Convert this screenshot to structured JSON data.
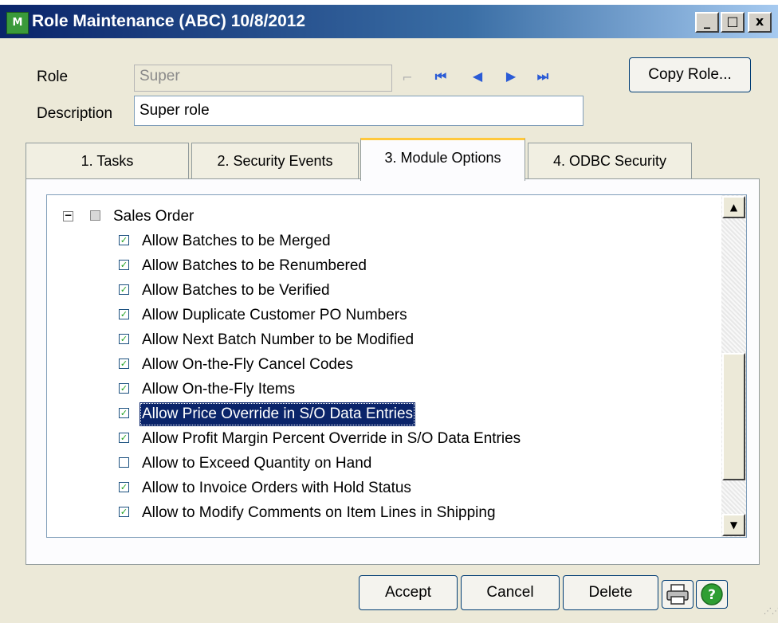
{
  "window": {
    "title": "Role Maintenance (ABC) 10/8/2012",
    "icon_label": "M"
  },
  "window_controls": {
    "minimize": "_",
    "maximize": "□",
    "close": "x"
  },
  "form": {
    "role_label": "Role",
    "role_value": "Super",
    "description_label": "Description",
    "description_value": "Super role",
    "copy_role_button": "Copy Role..."
  },
  "tabs": [
    {
      "label": "1. Tasks"
    },
    {
      "label": "2. Security Events"
    },
    {
      "label": "3. Module Options",
      "active": true
    },
    {
      "label": "4. ODBC Security"
    }
  ],
  "tree": {
    "parent_label": "Sales Order",
    "selected_index": 7,
    "items": [
      {
        "label": "Allow Batches to be Merged",
        "checked": true
      },
      {
        "label": "Allow Batches to be Renumbered",
        "checked": true
      },
      {
        "label": "Allow Batches to be Verified",
        "checked": true
      },
      {
        "label": "Allow Duplicate Customer PO Numbers",
        "checked": true
      },
      {
        "label": "Allow Next Batch Number to be Modified",
        "checked": true
      },
      {
        "label": "Allow On-the-Fly Cancel Codes",
        "checked": true
      },
      {
        "label": "Allow On-the-Fly Items",
        "checked": true
      },
      {
        "label": "Allow Price Override in S/O Data Entries",
        "checked": true
      },
      {
        "label": "Allow Profit Margin Percent Override in S/O Data Entries",
        "checked": true
      },
      {
        "label": "Allow to Exceed Quantity on Hand",
        "checked": false
      },
      {
        "label": "Allow to Invoice Orders with Hold Status",
        "checked": true
      },
      {
        "label": "Allow to Modify Comments on Item Lines in Shipping",
        "checked": true
      }
    ]
  },
  "buttons": {
    "accept": "Accept",
    "cancel": "Cancel",
    "delete": "Delete"
  },
  "icons": {
    "app": "app-icon",
    "lookup": "lookup-icon",
    "first": "first-record-icon",
    "previous": "previous-record-icon",
    "next": "next-record-icon",
    "last": "last-record-icon",
    "print": "printer-icon",
    "help": "help-icon"
  },
  "colors": {
    "title_bar": "#0a246a",
    "selection": "#0a246a",
    "help_green": "#2f9e33",
    "tab_highlight": "#ffc83c"
  }
}
